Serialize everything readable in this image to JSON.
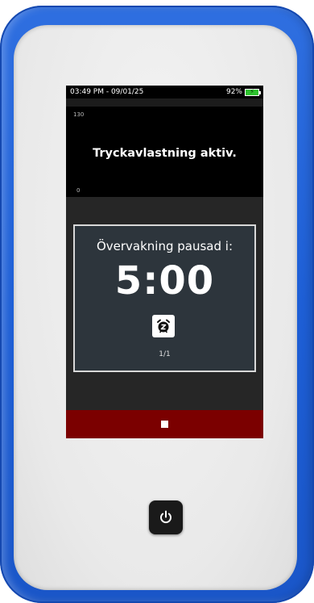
{
  "status_bar": {
    "datetime": "03:49 PM - 09/01/25",
    "battery_percent": "92%",
    "battery_level": 0.92,
    "battery_color": "#2ec12e",
    "charging_icon": "lightning-bolt-icon"
  },
  "graph": {
    "y_max_label": "130",
    "y_min_label": "0",
    "message": "Tryckavlastning aktiv."
  },
  "modal": {
    "title": "Övervakning pausad i:",
    "timer": "5:00",
    "snooze_icon": "alarm-clock-snooze-icon",
    "page_indicator": "1/1"
  },
  "stop_bar": {
    "icon": "stop-icon",
    "color": "#7b0000"
  },
  "device": {
    "power_icon": "power-icon",
    "shell_color": "#1e5fd6"
  }
}
